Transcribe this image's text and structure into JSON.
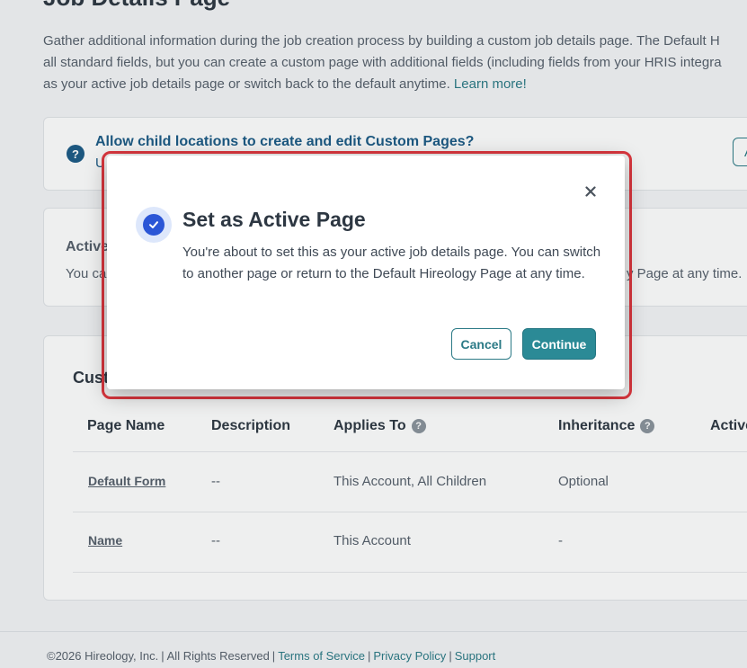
{
  "page": {
    "title": "Job Details Page",
    "intro_line1": "Gather additional information during the job creation process by building a custom job details page. The Default H",
    "intro_line2": "all standard fields, but you can create a custom page with additional fields (including fields from your HRIS integra",
    "intro_line3": "as your active job details page or switch back to the default anytime.",
    "learn_more": "Learn more!"
  },
  "banner": {
    "title": "Allow child locations to create and edit Custom Pages?",
    "subtitle": "U",
    "button": "A"
  },
  "active_card": {
    "title": "Active",
    "desc_left": "You ca",
    "desc_right": "y Page at any time."
  },
  "table": {
    "heading": "Custo",
    "columns": [
      "Page Name",
      "Description",
      "Applies To",
      "Inheritance",
      "Active"
    ],
    "rows": [
      {
        "name": "Default Form",
        "description": "--",
        "applies_to": "This Account, All Children",
        "inheritance": "Optional"
      },
      {
        "name": "Name",
        "description": "--",
        "applies_to": "This Account",
        "inheritance": "-"
      }
    ]
  },
  "footer": {
    "copyright": "©2026 Hireology, Inc.",
    "rights": "All Rights Reserved",
    "terms": "Terms of Service",
    "privacy": "Privacy Policy",
    "support": "Support"
  },
  "modal": {
    "title": "Set as Active Page",
    "body": "You're about to set this as your active job details page. You can switch to another page or return to the Default Hireology Page at any time.",
    "cancel": "Cancel",
    "continue": "Continue",
    "close_icon": "close-icon",
    "status_icon": "check-circle-icon",
    "accent_color": "#2b8a96",
    "highlight_color": "#d9363e"
  }
}
